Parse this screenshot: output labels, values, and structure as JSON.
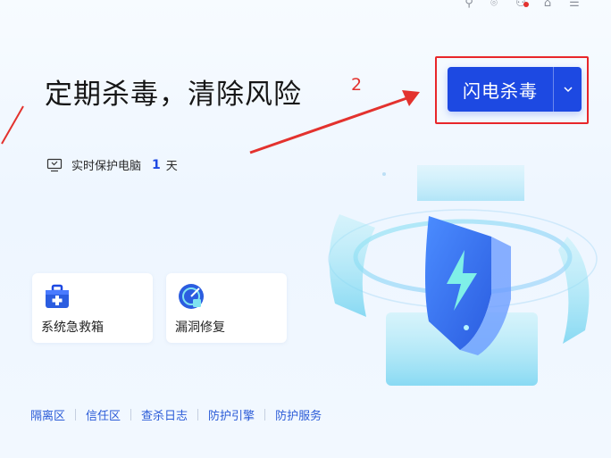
{
  "headline": "定期杀毒，清除风险",
  "scan_button": {
    "label": "闪电杀毒"
  },
  "annotation_number": "2",
  "protection": {
    "prefix": "实时保护电脑",
    "days": "1",
    "unit": "天"
  },
  "tools": [
    {
      "label": "系统急救箱",
      "icon": "first-aid-kit-icon"
    },
    {
      "label": "漏洞修复",
      "icon": "vulnerability-fix-icon"
    }
  ],
  "links": [
    "隔离区",
    "信任区",
    "查杀日志",
    "防护引擎",
    "防护服务"
  ],
  "colors": {
    "accent": "#1d49e2",
    "annotation": "#e3322e"
  }
}
